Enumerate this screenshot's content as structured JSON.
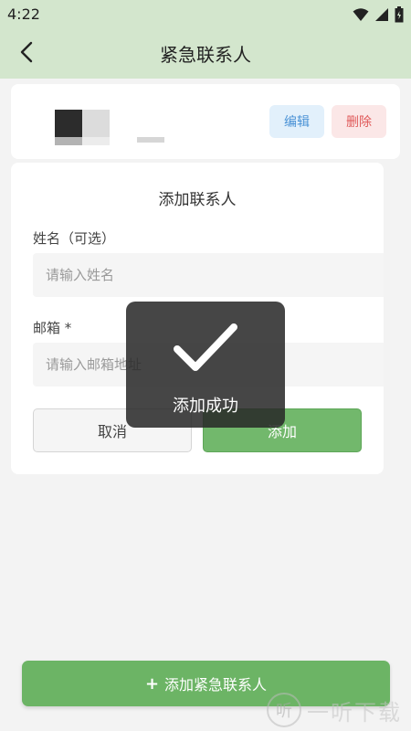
{
  "status": {
    "time": "4:22"
  },
  "appbar": {
    "title": "紧急联系人"
  },
  "contact": {
    "edit_label": "编辑",
    "delete_label": "删除"
  },
  "form": {
    "title": "添加联系人",
    "name_label": "姓名（可选）",
    "name_placeholder": "请输入姓名",
    "email_label": "邮箱 *",
    "email_placeholder": "请输入邮箱地址",
    "cancel_label": "取消",
    "add_label": "添加"
  },
  "toast": {
    "message": "添加成功",
    "icon": "checkmark-icon"
  },
  "bottom": {
    "add_contact_label": "添加紧急联系人",
    "icon": "plus-icon"
  },
  "watermark": {
    "text": "一听下载",
    "logo": "听"
  },
  "colors": {
    "header_bg": "#d3e6cd",
    "primary_green": "#6cb465",
    "edit_blue": "#4a92d6",
    "delete_red": "#e05a5a"
  }
}
